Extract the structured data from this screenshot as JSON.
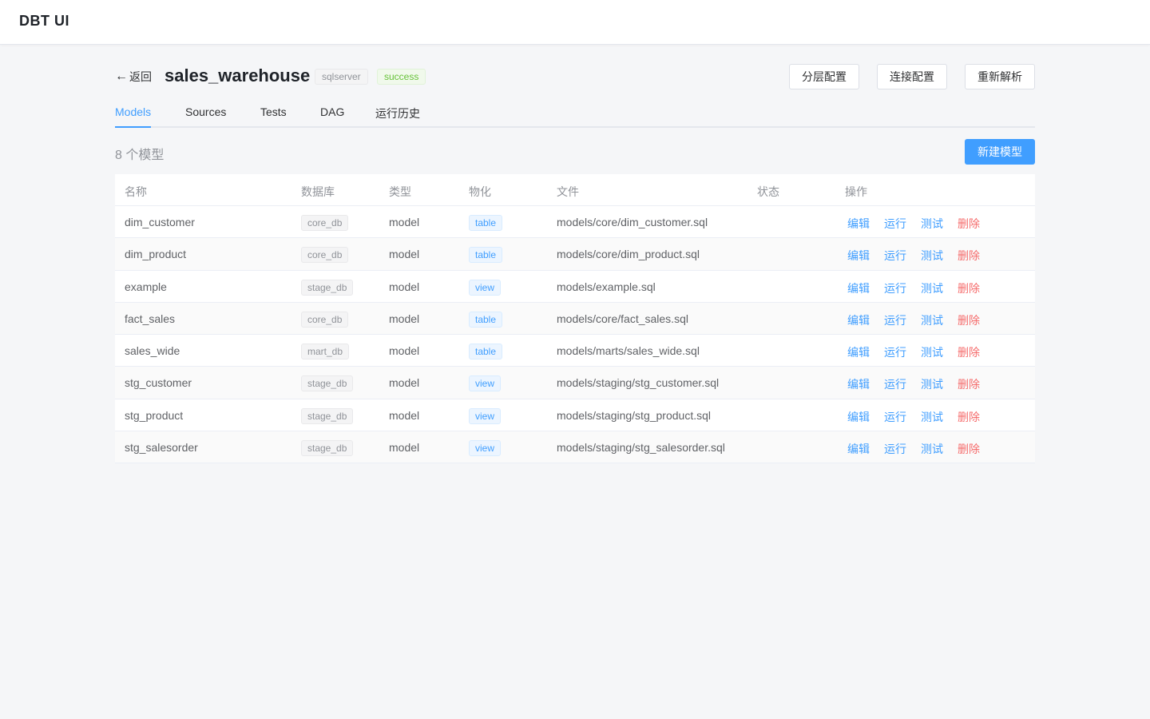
{
  "app": {
    "title": "DBT UI"
  },
  "header": {
    "back_arrow": "←",
    "back_label": "返回",
    "project_name": "sales_warehouse",
    "adapter_tag": "sqlserver",
    "status_tag": "success",
    "buttons": {
      "layer_config": "分层配置",
      "connection_config": "连接配置",
      "reparse": "重新解析"
    }
  },
  "tabs": [
    {
      "label": "Models",
      "active": true
    },
    {
      "label": "Sources",
      "active": false
    },
    {
      "label": "Tests",
      "active": false
    },
    {
      "label": "DAG",
      "active": false
    },
    {
      "label": "运行历史",
      "active": false
    }
  ],
  "toolbar": {
    "count_text": "8 个模型",
    "new_model_label": "新建模型"
  },
  "table": {
    "columns": [
      "名称",
      "数据库",
      "类型",
      "物化",
      "文件",
      "状态",
      "操作"
    ],
    "actions": {
      "edit": "编辑",
      "run": "运行",
      "test": "测试",
      "delete": "删除"
    },
    "rows": [
      {
        "name": "dim_customer",
        "database": "core_db",
        "type": "model",
        "materialized": "table",
        "file": "models/core/dim_customer.sql",
        "status": ""
      },
      {
        "name": "dim_product",
        "database": "core_db",
        "type": "model",
        "materialized": "table",
        "file": "models/core/dim_product.sql",
        "status": ""
      },
      {
        "name": "example",
        "database": "stage_db",
        "type": "model",
        "materialized": "view",
        "file": "models/example.sql",
        "status": ""
      },
      {
        "name": "fact_sales",
        "database": "core_db",
        "type": "model",
        "materialized": "table",
        "file": "models/core/fact_sales.sql",
        "status": ""
      },
      {
        "name": "sales_wide",
        "database": "mart_db",
        "type": "model",
        "materialized": "table",
        "file": "models/marts/sales_wide.sql",
        "status": ""
      },
      {
        "name": "stg_customer",
        "database": "stage_db",
        "type": "model",
        "materialized": "view",
        "file": "models/staging/stg_customer.sql",
        "status": ""
      },
      {
        "name": "stg_product",
        "database": "stage_db",
        "type": "model",
        "materialized": "view",
        "file": "models/staging/stg_product.sql",
        "status": ""
      },
      {
        "name": "stg_salesorder",
        "database": "stage_db",
        "type": "model",
        "materialized": "view",
        "file": "models/staging/stg_salesorder.sql",
        "status": ""
      }
    ]
  },
  "colors": {
    "primary": "#409eff",
    "success": "#67c23a",
    "danger": "#f56c6c",
    "background": "#f5f6f8"
  }
}
